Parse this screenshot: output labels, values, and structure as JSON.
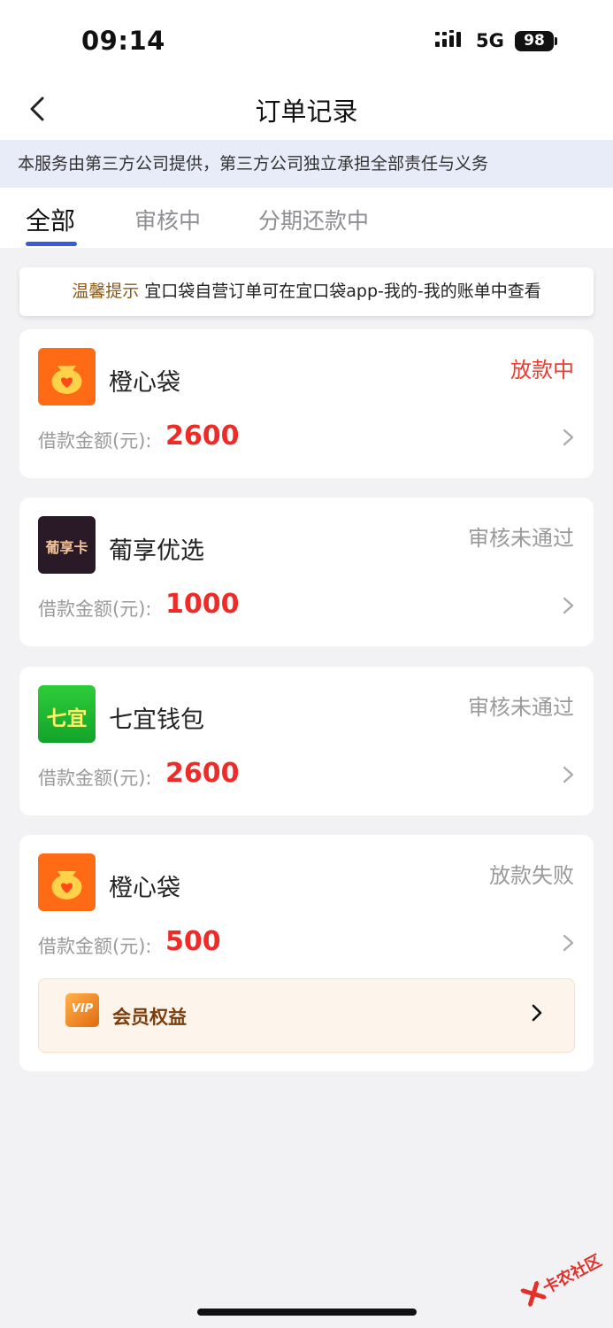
{
  "status_bar": {
    "time": "09:14",
    "network": "5G",
    "battery": "98"
  },
  "nav": {
    "title": "订单记录"
  },
  "notice": "本服务由第三方公司提供，第三方公司独立承担全部责任与义务",
  "tabs": [
    {
      "label": "全部",
      "active": true
    },
    {
      "label": "审核中",
      "active": false
    },
    {
      "label": "分期还款中",
      "active": false
    }
  ],
  "tip": {
    "label": "温馨提示",
    "text": "宜口袋自营订单可在宜口袋app-我的-我的账单中查看"
  },
  "orders": [
    {
      "name": "橙心袋",
      "status": "放款中",
      "amount_label": "借款金额(元):",
      "amount": "2600",
      "logo": "orange-money-bag-icon"
    },
    {
      "name": "葡享优选",
      "status": "审核未通过",
      "amount_label": "借款金额(元):",
      "amount": "1000",
      "logo": "grape-card-icon",
      "logo_text": "葡享卡"
    },
    {
      "name": "七宜钱包",
      "status": "审核未通过",
      "amount_label": "借款金额(元):",
      "amount": "2600",
      "logo": "green-qiyi-icon",
      "logo_text": "七宜"
    },
    {
      "name": "橙心袋",
      "status": "放款失败",
      "amount_label": "借款金额(元):",
      "amount": "500",
      "logo": "orange-money-bag-icon"
    }
  ],
  "vip": {
    "label": "会员权益",
    "icon_text": "VIP"
  },
  "watermark": {
    "text": "卡农社区"
  },
  "colors": {
    "accent": "#3a5bd9",
    "amount_red": "#ee2b26",
    "status_red": "#ee3b2f",
    "status_gray": "#9a9a9a",
    "vip_bg": "#fdf4ec"
  }
}
